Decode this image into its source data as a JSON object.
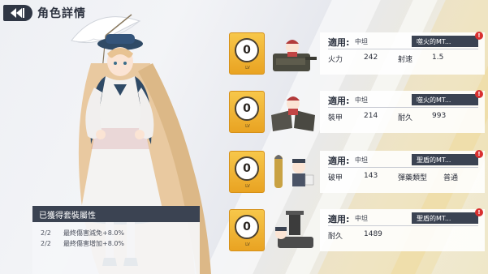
{
  "header": {
    "title": "角色詳情"
  },
  "set_bonus": {
    "title": "已獲得套裝屬性",
    "items": [
      {
        "count": "2/2",
        "text": "最終傷害減免+8.0%"
      },
      {
        "count": "2/2",
        "text": "最終傷害增加+8.0%"
      }
    ]
  },
  "equipment": [
    {
      "level": "0",
      "level_caption": "LV",
      "usage_key": "適用:",
      "usage_val": "中坦",
      "name": "噬火的MT...",
      "alert": "!",
      "stats": [
        {
          "label": "火力",
          "value": "242"
        },
        {
          "label": "射速",
          "value": "1.5"
        }
      ]
    },
    {
      "level": "0",
      "level_caption": "LV",
      "usage_key": "適用:",
      "usage_val": "中坦",
      "name": "噬火的MT...",
      "alert": "!",
      "stats": [
        {
          "label": "裝甲",
          "value": "214"
        },
        {
          "label": "耐久",
          "value": "993"
        }
      ]
    },
    {
      "level": "0",
      "level_caption": "LV",
      "usage_key": "適用:",
      "usage_val": "中坦",
      "name": "聖盾的MT...",
      "alert": "!",
      "stats": [
        {
          "label": "破甲",
          "value": "143"
        },
        {
          "label": "彈藥類型",
          "value": "普通"
        }
      ]
    },
    {
      "level": "0",
      "level_caption": "LV",
      "usage_key": "適用:",
      "usage_val": "中坦",
      "name": "聖盾的MT...",
      "alert": "!",
      "stats": [
        {
          "label": "耐久",
          "value": "1489"
        }
      ]
    }
  ],
  "colors": {
    "accent_gold": "#f0b93a",
    "panel_dark": "#3b4352",
    "alert_red": "#d9302f"
  }
}
